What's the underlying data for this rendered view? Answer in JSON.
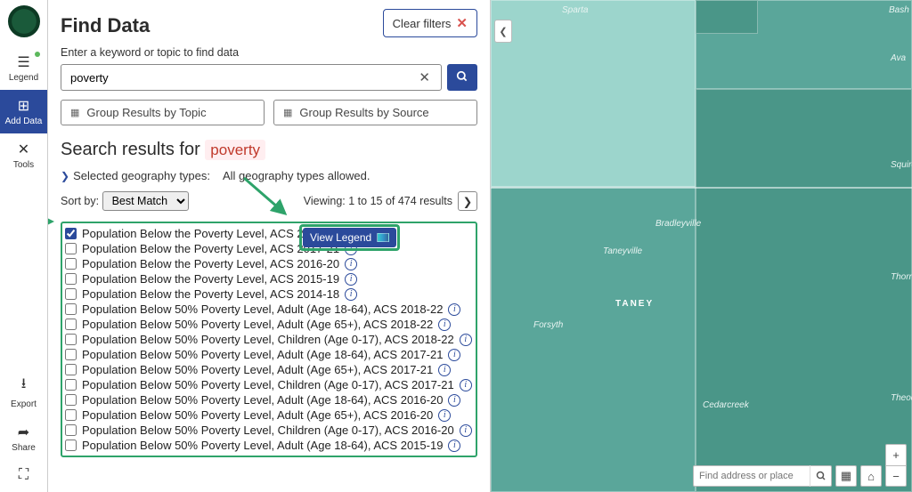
{
  "sidebar": {
    "items": [
      {
        "label": "Legend"
      },
      {
        "label": "Add Data"
      },
      {
        "label": "Tools"
      },
      {
        "label": "Export"
      },
      {
        "label": "Share"
      }
    ]
  },
  "panel": {
    "title": "Find Data",
    "subtitle": "Enter a keyword or topic to find data",
    "clear_filters": "Clear filters",
    "search_value": "poverty",
    "group_topic": "Group Results by Topic",
    "group_source": "Group Results by Source",
    "results_prefix": "Search results for",
    "results_term": "poverty",
    "geo_label": "Selected geography types:",
    "geo_value": "All geography types allowed.",
    "sort_label": "Sort by:",
    "sort_value": "Best Match",
    "viewing": "Viewing: 1 to 15 of 474 results",
    "view_legend": "View Legend",
    "results": [
      {
        "checked": true,
        "label": "Population Below the Poverty Level, ACS 2018-22"
      },
      {
        "checked": false,
        "label": "Population Below the Poverty Level, ACS 2017-21"
      },
      {
        "checked": false,
        "label": "Population Below the Poverty Level, ACS 2016-20"
      },
      {
        "checked": false,
        "label": "Population Below the Poverty Level, ACS 2015-19"
      },
      {
        "checked": false,
        "label": "Population Below the Poverty Level, ACS 2014-18"
      },
      {
        "checked": false,
        "label": "Population Below 50% Poverty Level, Adult (Age 18-64), ACS 2018-22"
      },
      {
        "checked": false,
        "label": "Population Below 50% Poverty Level, Adult (Age 65+), ACS 2018-22"
      },
      {
        "checked": false,
        "label": "Population Below 50% Poverty Level, Children (Age 0-17), ACS 2018-22"
      },
      {
        "checked": false,
        "label": "Population Below 50% Poverty Level, Adult (Age 18-64), ACS 2017-21"
      },
      {
        "checked": false,
        "label": "Population Below 50% Poverty Level, Adult (Age 65+), ACS 2017-21"
      },
      {
        "checked": false,
        "label": "Population Below 50% Poverty Level, Children (Age 0-17), ACS 2017-21"
      },
      {
        "checked": false,
        "label": "Population Below 50% Poverty Level, Adult (Age 18-64), ACS 2016-20"
      },
      {
        "checked": false,
        "label": "Population Below 50% Poverty Level, Adult (Age 65+), ACS 2016-20"
      },
      {
        "checked": false,
        "label": "Population Below 50% Poverty Level, Children (Age 0-17), ACS 2016-20"
      },
      {
        "checked": false,
        "label": "Population Below 50% Poverty Level, Adult (Age 18-64), ACS 2015-19"
      }
    ]
  },
  "map": {
    "labels": {
      "sparta": "Sparta",
      "bash": "Bash",
      "ava": "Ava",
      "squires": "Squires",
      "bradleyville": "Bradleyville",
      "taneyville": "Taneyville",
      "taney": "TANEY",
      "thornfield": "Thornfield",
      "forsyth": "Forsyth",
      "cedarcreek": "Cedarcreek",
      "theodosi": "Theodosi"
    },
    "search_placeholder": "Find address or place"
  }
}
